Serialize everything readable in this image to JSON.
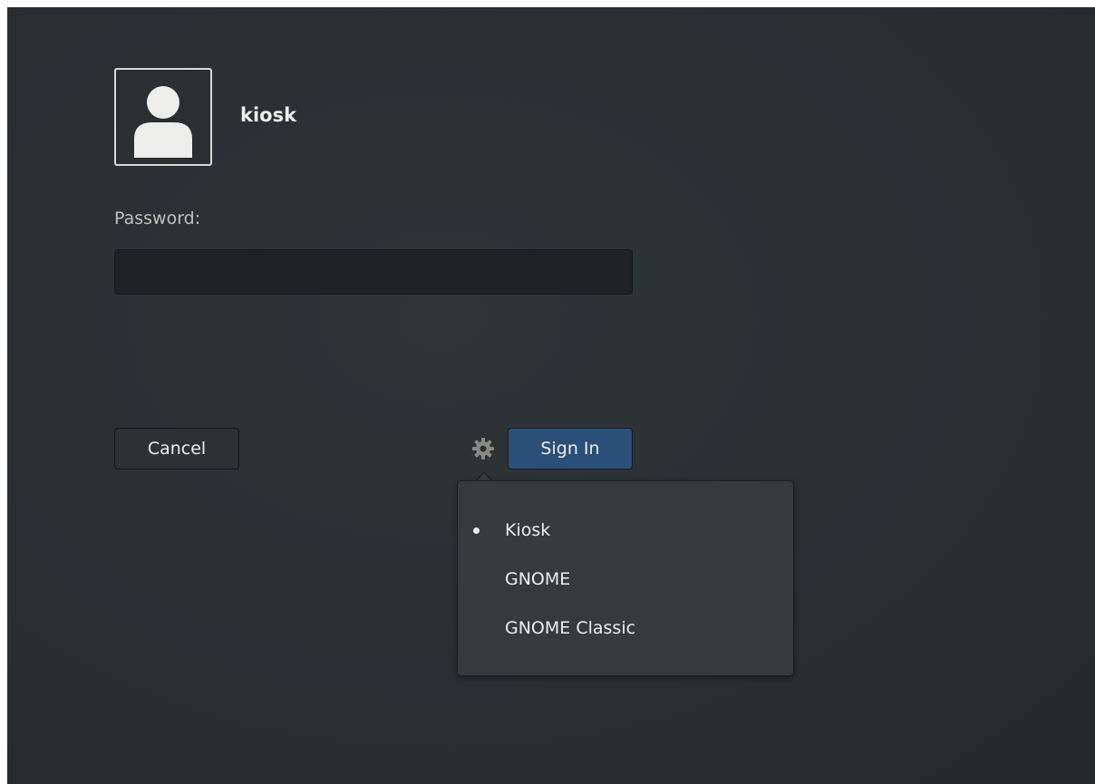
{
  "user": {
    "name": "kiosk"
  },
  "login": {
    "password_label": "Password:",
    "password_value": ""
  },
  "buttons": {
    "cancel_label": "Cancel",
    "signin_label": "Sign In"
  },
  "icons": {
    "avatar": "user-avatar-icon",
    "session": "gear-icon",
    "selected": "bullet-icon"
  },
  "session_menu": {
    "items": [
      {
        "label": "Kiosk",
        "selected": true
      },
      {
        "label": "GNOME",
        "selected": false
      },
      {
        "label": "GNOME Classic",
        "selected": false
      }
    ]
  },
  "colors": {
    "background": "#2c3033",
    "signin_accent": "#2a4f78",
    "menu_background": "#363a3c",
    "text": "#eeeeec"
  }
}
